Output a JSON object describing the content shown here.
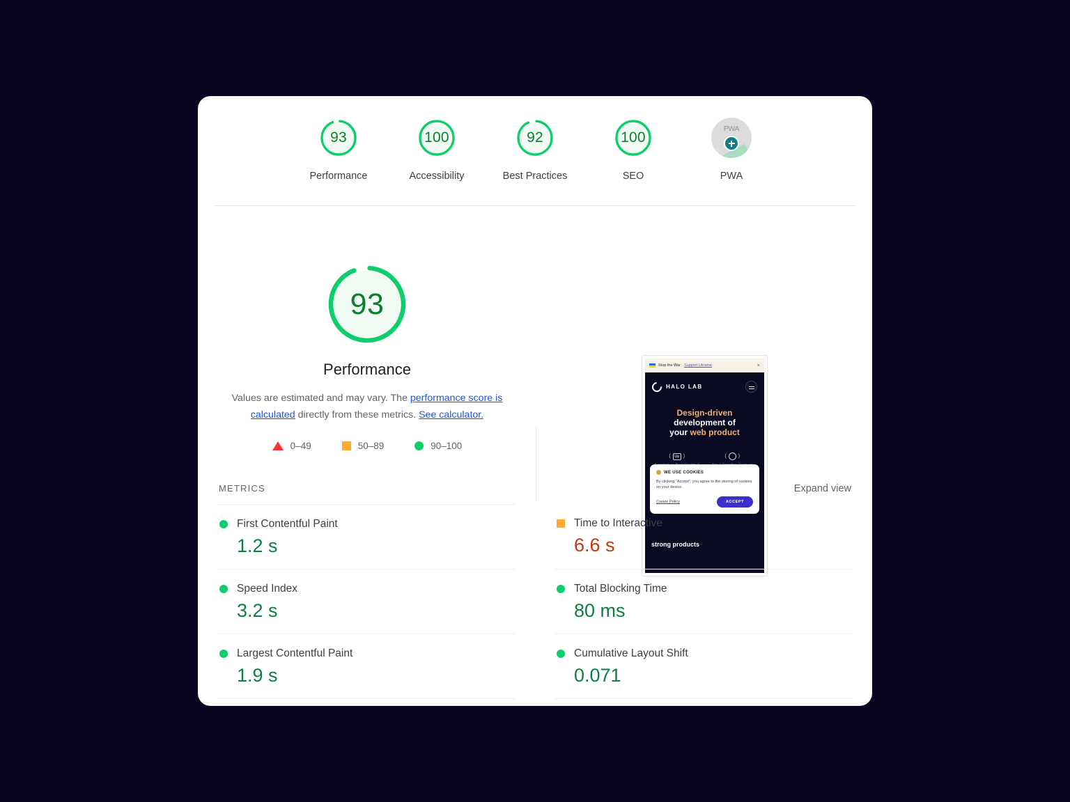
{
  "theme": {
    "page_background": "#0a0620",
    "card_background": "#ffffff",
    "pass_green": "#0cce6b",
    "pass_text_green": "#0b8043",
    "average_orange": "#ffaa33",
    "fail_red": "#ff3333",
    "warn_text": "#c1390c",
    "link_blue": "#1a56db"
  },
  "category_scores": [
    {
      "score": "93",
      "label": "Performance",
      "percent": 93,
      "status": "pass"
    },
    {
      "score": "100",
      "label": "Accessibility",
      "percent": 100,
      "status": "pass"
    },
    {
      "score": "92",
      "label": "Best Practices",
      "percent": 92,
      "status": "pass"
    },
    {
      "score": "100",
      "label": "SEO",
      "percent": 100,
      "status": "pass"
    },
    {
      "score": "",
      "label": "PWA",
      "percent": 0,
      "status": "pwa",
      "badge_text": "PWA"
    }
  ],
  "hero": {
    "score": "93",
    "title": "Performance",
    "description_prefix": "Values are estimated and may vary. The ",
    "link_calculated": "performance score is calculated",
    "description_middle": " directly from these metrics. ",
    "link_calculator": "See calculator.",
    "legend": [
      {
        "shape": "triangle",
        "label": "0–49",
        "color": "#ff3333"
      },
      {
        "shape": "square",
        "label": "50–89",
        "color": "#ffaa33"
      },
      {
        "shape": "circle",
        "label": "90–100",
        "color": "#0cce6b"
      }
    ]
  },
  "thumbnail": {
    "banner": {
      "text": "Stop the War.",
      "link": "Support Ukraine",
      "close": "×"
    },
    "brand": "HALO LAB",
    "headline_line1_a": "Design-driven",
    "headline_line2": "development of",
    "headline_line3_a": "your ",
    "headline_line3_b": "web product",
    "awards": [
      {
        "badge": "Up",
        "text": "Awarded as Best Design &"
      },
      {
        "badge": "⚽",
        "text": "Top-1 Trending Team on"
      }
    ],
    "strong_products": "strong products",
    "cookie": {
      "title": "WE USE COOKIES",
      "body": "By clicking “Accept”, you agree to the storing of cookies on your device.",
      "policy_link": "Cookie Policy",
      "accept_button": "ACCEPT"
    }
  },
  "metrics_section": {
    "title": "METRICS",
    "expand_view": "Expand view",
    "items": [
      {
        "name": "First Contentful Paint",
        "value": "1.2 s",
        "status": "pass",
        "column": "left"
      },
      {
        "name": "Speed Index",
        "value": "3.2 s",
        "status": "pass",
        "column": "left"
      },
      {
        "name": "Largest Contentful Paint",
        "value": "1.9 s",
        "status": "pass",
        "column": "left"
      },
      {
        "name": "Time to Interactive",
        "value": "6.6 s",
        "status": "average",
        "column": "right"
      },
      {
        "name": "Total Blocking Time",
        "value": "80 ms",
        "status": "pass",
        "column": "right"
      },
      {
        "name": "Cumulative Layout Shift",
        "value": "0.071",
        "status": "pass",
        "column": "right"
      }
    ]
  }
}
